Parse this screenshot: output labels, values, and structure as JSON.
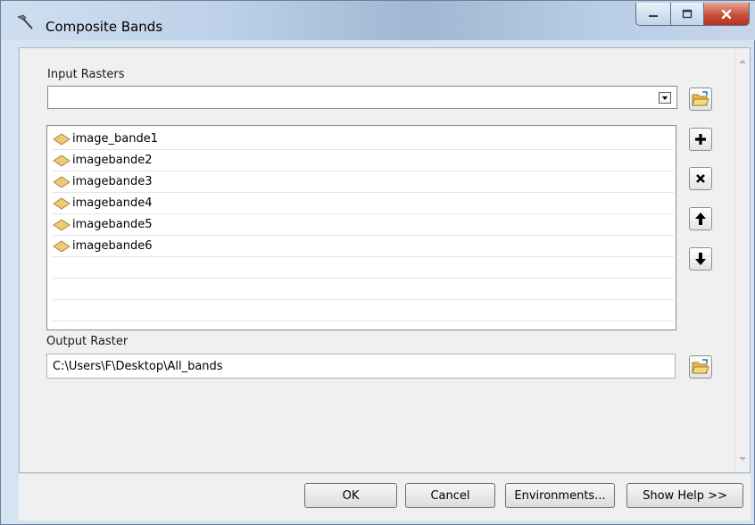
{
  "window": {
    "title": "Composite Bands",
    "tool_icon": "hammer-icon"
  },
  "input_rasters": {
    "label": "Input Rasters",
    "value": "",
    "items": [
      "image_bande1",
      "imagebande2",
      "imagebande3",
      "imagebande4",
      "imagebande5",
      "imagebande6"
    ]
  },
  "output_raster": {
    "label": "Output Raster",
    "value": "C:\\Users\\F\\Desktop\\All_bands"
  },
  "buttons": {
    "ok": "OK",
    "cancel": "Cancel",
    "environments": "Environments...",
    "show_help": "Show Help >>"
  },
  "icons": {
    "browse": "folder-open-icon",
    "add": "plus-icon",
    "remove": "x-icon",
    "move_up": "arrow-up-icon",
    "move_down": "arrow-down-icon",
    "raster_item": "raster-layer-icon"
  },
  "colors": {
    "title_bar": "#bcd0e8",
    "close_button": "#c8503a",
    "dialog_background": "#f0f0f0"
  }
}
